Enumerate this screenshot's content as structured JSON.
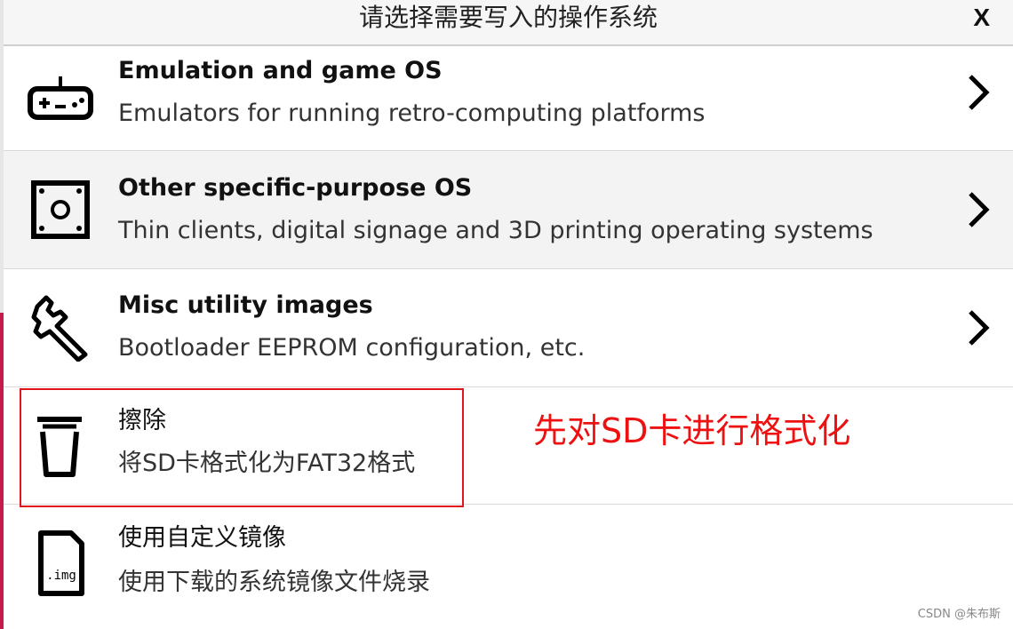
{
  "dialog": {
    "title": "请选择需要写入的操作系统",
    "close_label": "X"
  },
  "items": [
    {
      "title": "Emulation and game OS",
      "description": "Emulators for running retro-computing platforms",
      "icon": "gamepad-icon",
      "has_chevron": true
    },
    {
      "title": "Other specific-purpose OS",
      "description": "Thin clients, digital signage and 3D printing operating systems",
      "icon": "square-device-icon",
      "has_chevron": true
    },
    {
      "title": "Misc utility images",
      "description": "Bootloader EEPROM configuration, etc.",
      "icon": "wrench-icon",
      "has_chevron": true
    },
    {
      "title": "擦除",
      "description": "将SD卡格式化为FAT32格式",
      "icon": "trash-icon",
      "has_chevron": false
    },
    {
      "title": "使用自定义镜像",
      "description": "使用下载的系统镜像文件烧录",
      "icon": "img-file-icon",
      "has_chevron": false
    }
  ],
  "annotation": {
    "text": "先对SD卡进行格式化",
    "color": "#ee1111"
  },
  "watermark": "CSDN @朱布斯",
  "colors": {
    "accent_strip": "#c51a4a",
    "highlight_border": "#e5141c"
  }
}
